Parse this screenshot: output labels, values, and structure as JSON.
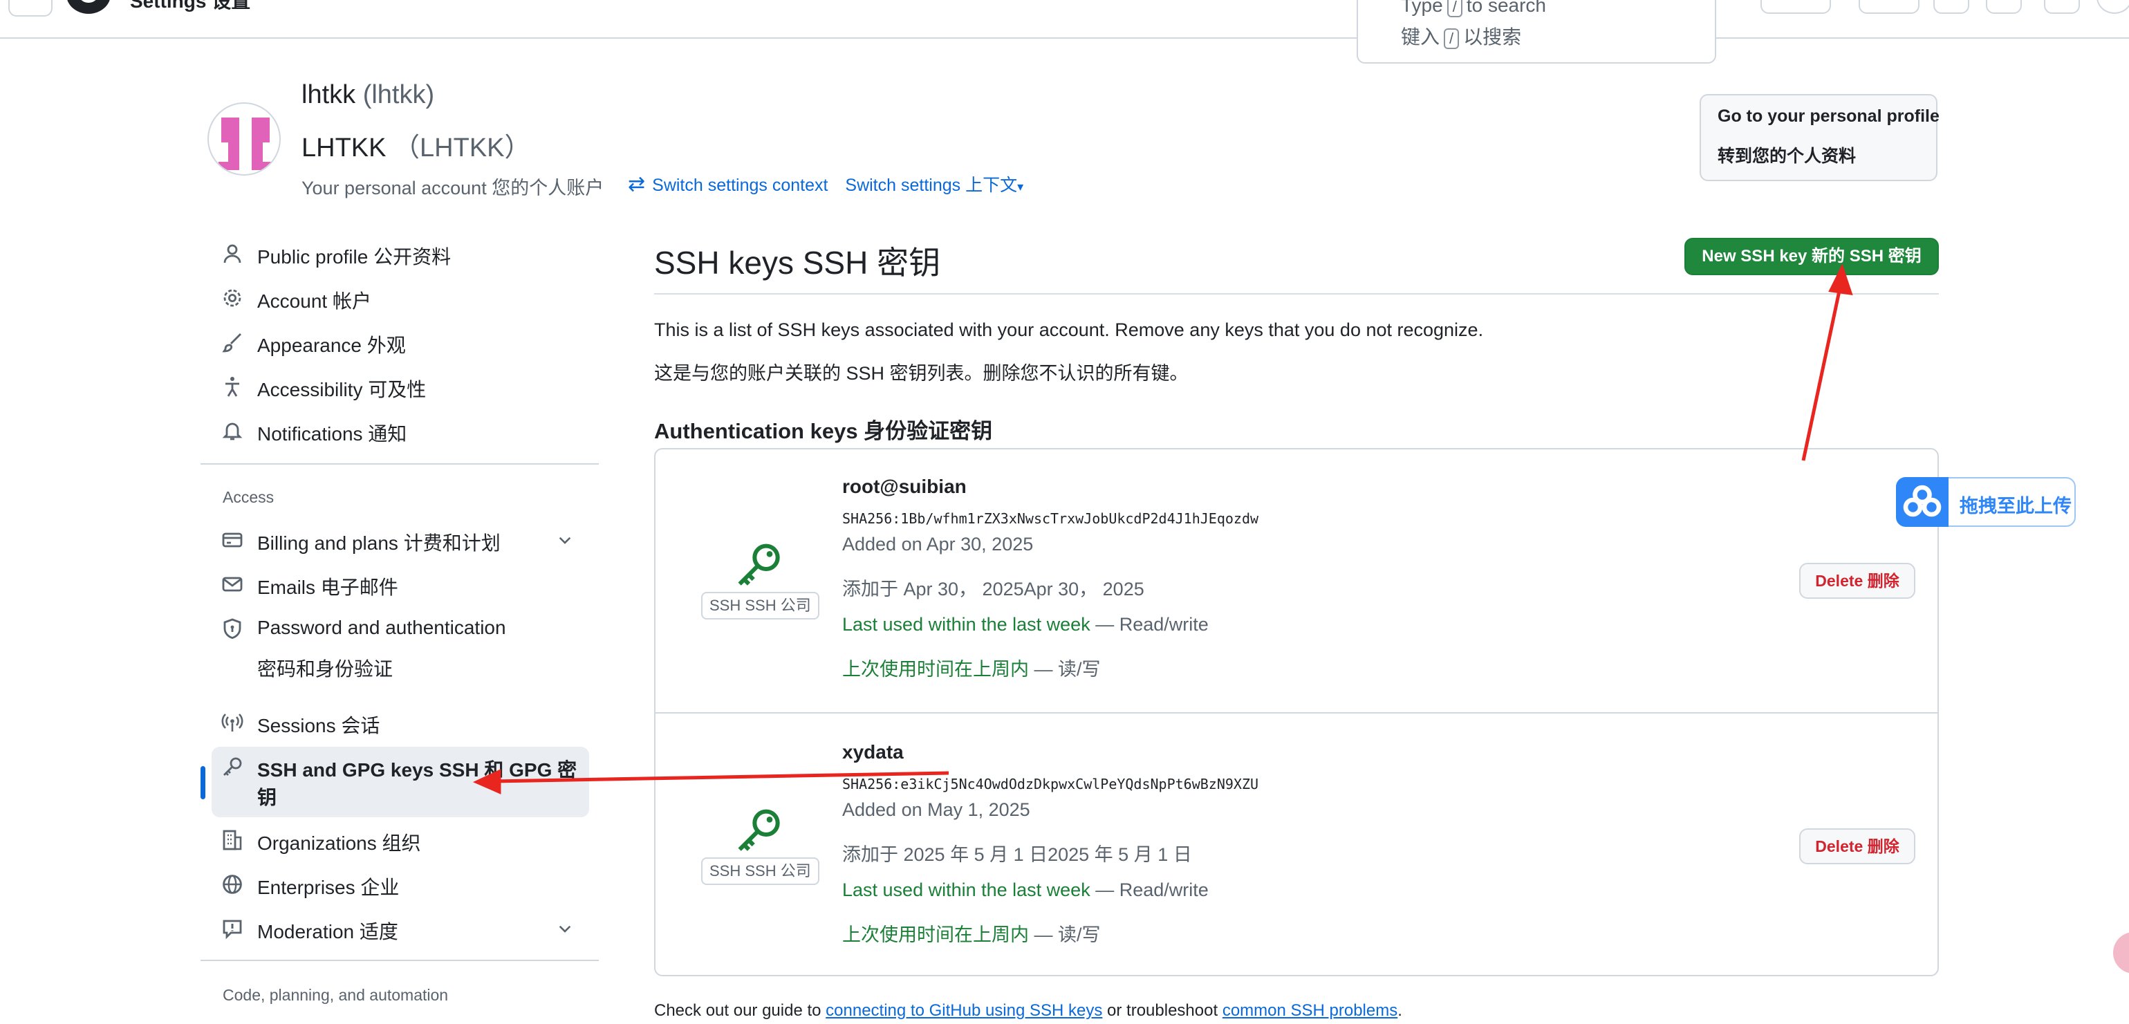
{
  "topbar": {
    "title": "Settings 设置",
    "search_line1": "Type",
    "search_key": "/",
    "search_line1_suffix": "to search",
    "search_line2_prefix": "键入",
    "search_line2_suffix": "以搜索"
  },
  "header": {
    "display_name": "lhtkk",
    "login": "(lhtkk)",
    "display_name_cn": "LHTKK",
    "login_cn": "（LHTKK）",
    "account_label": "Your personal account   您的个人账户",
    "switch_context": "Switch settings context",
    "switch_context_cn": "Switch settings 上下文",
    "profile_button_line1": "Go to your personal profile",
    "profile_button_line2": "转到您的个人资料"
  },
  "sidebar": {
    "items_top": [
      {
        "label": "Public profile   公开资料",
        "icon": "person-icon"
      },
      {
        "label": "Account   帐户",
        "icon": "gear-icon"
      },
      {
        "label": "Appearance   外观",
        "icon": "paintbrush-icon"
      },
      {
        "label": "Accessibility   可及性",
        "icon": "accessibility-icon"
      },
      {
        "label": "Notifications   通知",
        "icon": "bell-icon"
      }
    ],
    "access_heading": "Access",
    "items_access": [
      {
        "label": "Billing and plans   计费和计划",
        "icon": "credit-card-icon"
      },
      {
        "label": "Emails   电子邮件",
        "icon": "mail-icon"
      },
      {
        "label": "Password and authentication",
        "label2": "密码和身份验证",
        "icon": "shield-lock-icon"
      },
      {
        "label": "Sessions   会话",
        "icon": "broadcast-icon"
      },
      {
        "label": "SSH and GPG keys   SSH 和 GPG 密",
        "label2": "钥",
        "icon": "key-icon"
      },
      {
        "label": "Organizations   组织",
        "icon": "organization-icon"
      },
      {
        "label": "Enterprises   企业",
        "icon": "globe-icon"
      },
      {
        "label": "Moderation   适度",
        "icon": "report-icon"
      }
    ],
    "code_heading": "Code, planning, and automation"
  },
  "main": {
    "title": "SSH keys  SSH 密钥",
    "new_button": "New SSH key   新的 SSH 密钥",
    "description": "This is a list of SSH keys associated with your account. Remove any keys that you do not recognize.",
    "description_cn": "这是与您的账户关联的 SSH 密钥列表。删除您不认识的所有键。",
    "auth_heading": "Authentication keys  身份验证密钥",
    "keys": [
      {
        "title": "root@suibian",
        "fingerprint": "SHA256:1Bb/wfhm1rZX3xNwscTrxwJobUkcdP2d4J1hJEqozdw",
        "added": "Added on Apr 30, 2025",
        "added_cn": "添加于 Apr 30， 2025Apr 30， 2025",
        "used_green": "Last used within the last week",
        "used_rest": " — Read/write",
        "used_green_cn": "上次使用时间在上周内",
        "used_rest_cn": " — 读/写",
        "badge": "SSH   SSH 公司",
        "delete": "Delete   删除"
      },
      {
        "title": "xydata",
        "fingerprint": "SHA256:e3ikCj5Nc4OwdOdzDkpwxCwlPeYQdsNpPt6wBzN9XZU",
        "added": "Added on May 1, 2025",
        "added_cn": "添加于 2025 年 5 月 1 日2025 年 5 月 1 日",
        "used_green": "Last used within the last week",
        "used_rest": " — Read/write",
        "used_green_cn": "上次使用时间在上周内",
        "used_rest_cn": " — 读/写",
        "badge": "SSH   SSH 公司",
        "delete": "Delete   删除"
      }
    ],
    "footer_prefix": "Check out our guide to ",
    "footer_link1": "connecting to GitHub using SSH keys",
    "footer_mid": " or troubleshoot ",
    "footer_link2": "common SSH problems",
    "footer_suffix": "."
  },
  "upload_widget": {
    "label": "拖拽至此上传",
    "icon": "cloud-upload-icon"
  },
  "colors": {
    "primary_green": "#1f883d",
    "link_blue": "#0969da",
    "danger_red": "#d1242f",
    "annotation_red": "#e8261f"
  }
}
